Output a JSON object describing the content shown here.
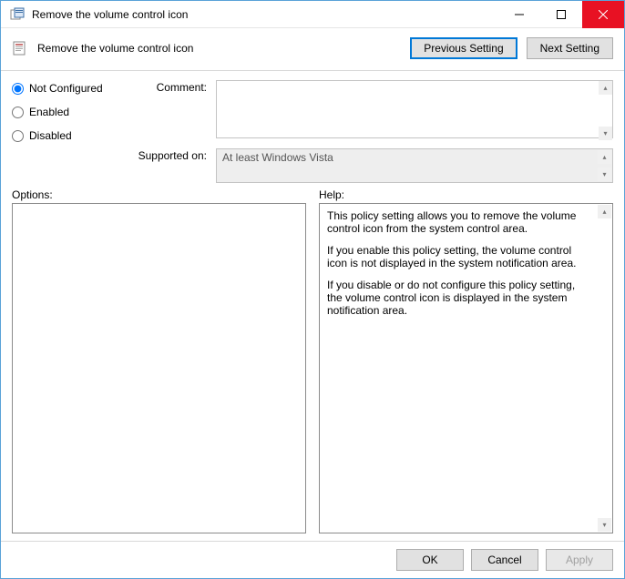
{
  "titlebar": {
    "text": "Remove the volume control icon"
  },
  "header": {
    "title": "Remove the volume control icon",
    "prev_btn": "Previous Setting",
    "next_btn": "Next Setting"
  },
  "radios": {
    "not_configured": "Not Configured",
    "enabled": "Enabled",
    "disabled": "Disabled",
    "selected": "not_configured"
  },
  "fields": {
    "comment_label": "Comment:",
    "comment_value": "",
    "supported_label": "Supported on:",
    "supported_value": "At least Windows Vista"
  },
  "panels": {
    "options_label": "Options:",
    "help_label": "Help:",
    "help_p1": "This policy setting allows you to remove the volume control icon from the system control area.",
    "help_p2": "If you enable this policy setting, the volume control icon is not displayed in the system notification area.",
    "help_p3": "If you disable or do not configure this policy setting, the volume control icon is displayed in the system notification area."
  },
  "footer": {
    "ok": "OK",
    "cancel": "Cancel",
    "apply": "Apply"
  }
}
